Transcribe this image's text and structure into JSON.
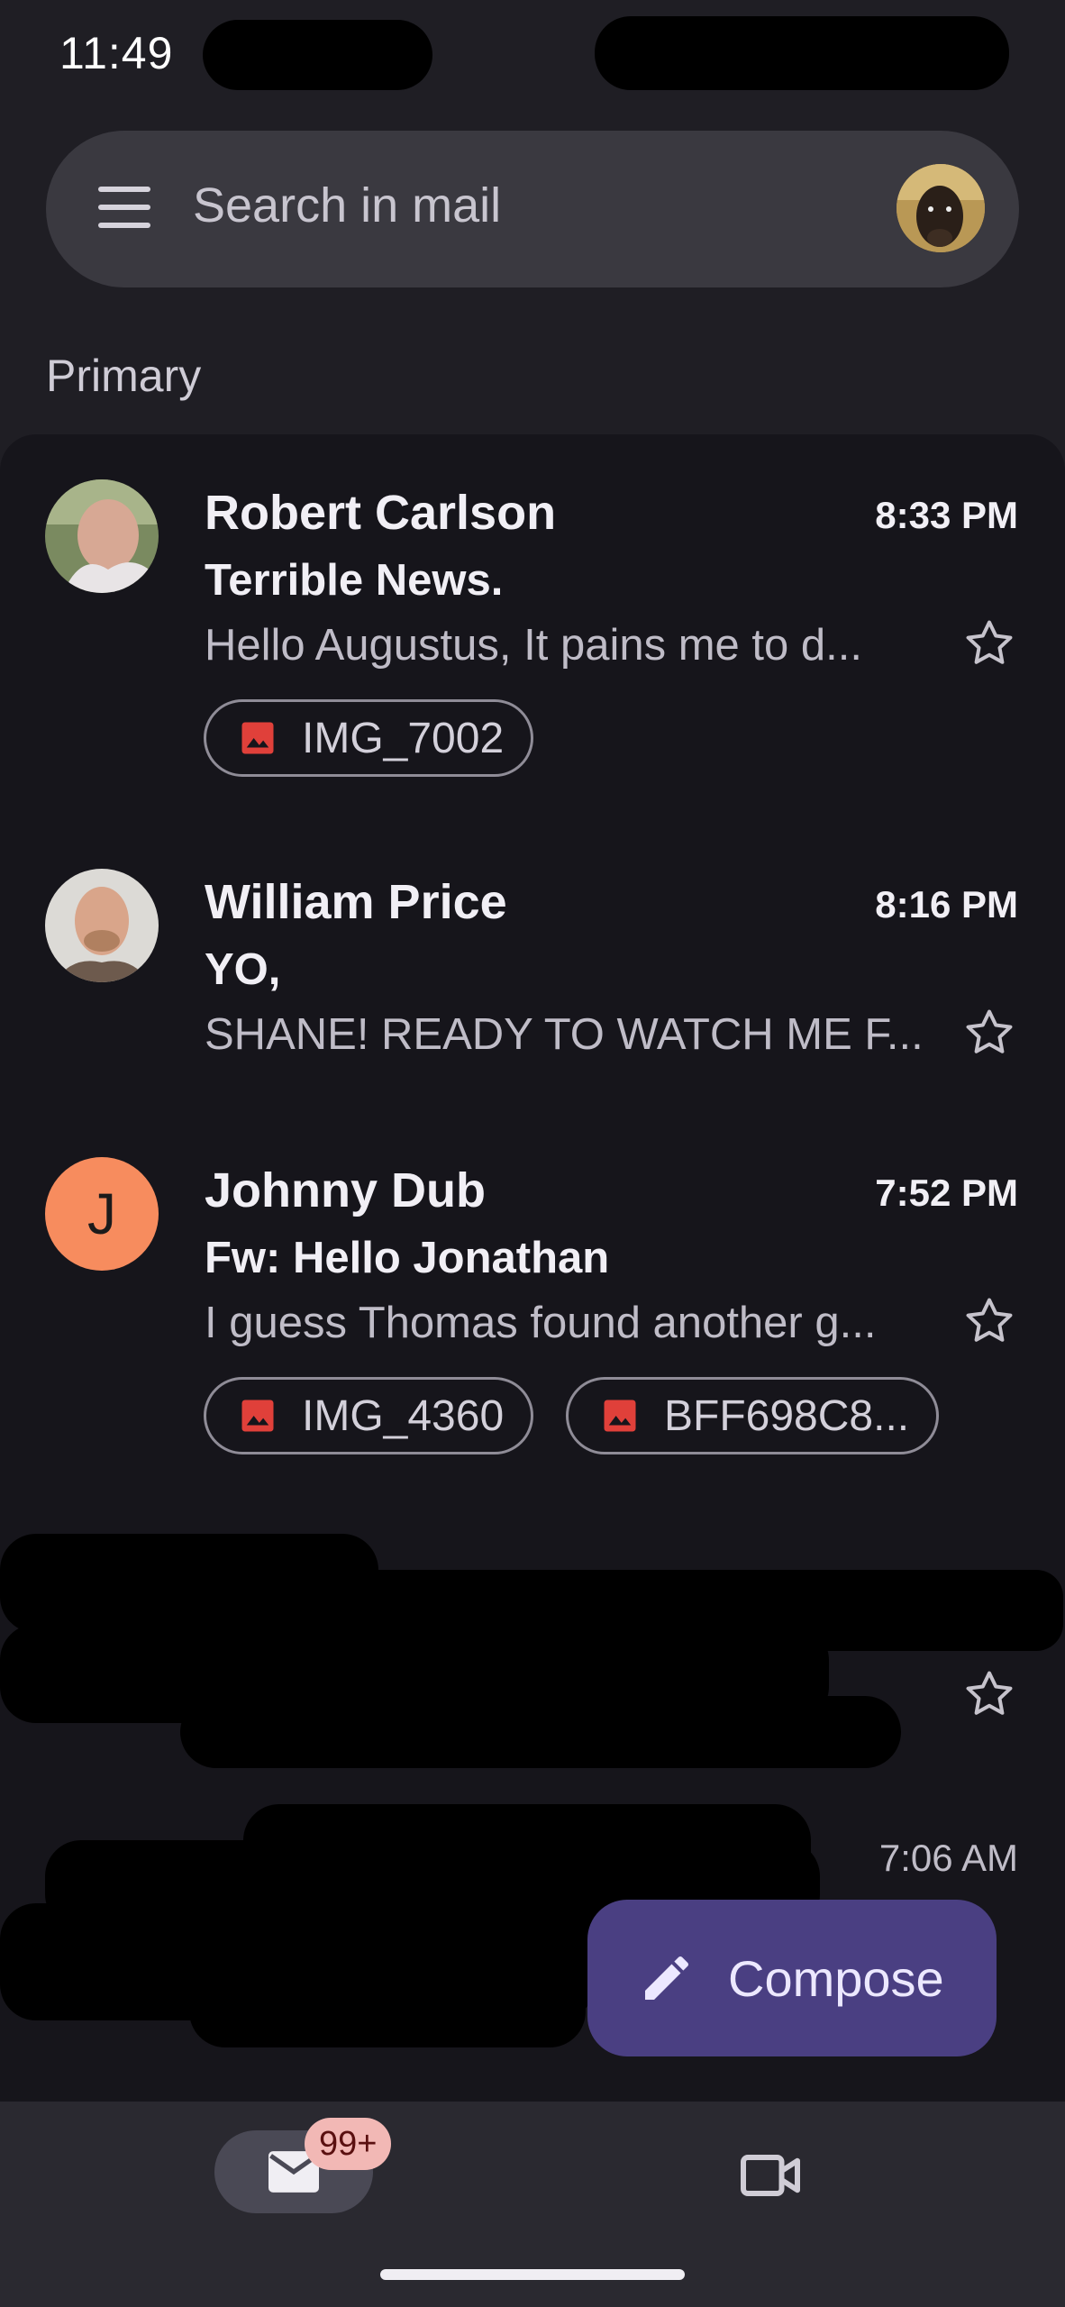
{
  "status_bar": {
    "time": "11:49"
  },
  "search": {
    "placeholder": "Search in mail"
  },
  "section": {
    "label": "Primary"
  },
  "emails": [
    {
      "sender": "Robert Carlson",
      "time": "8:33 PM",
      "subject": "Terrible News.",
      "snippet": "Hello Augustus, It pains me to d...",
      "attachments": [
        "IMG_7002"
      ]
    },
    {
      "sender": "William Price",
      "time": "8:16 PM",
      "subject": "YO,",
      "snippet": "SHANE! READY TO WATCH ME F..."
    },
    {
      "sender": "Johnny Dub",
      "avatar_letter": "J",
      "time": "7:52 PM",
      "subject": "Fw: Hello Jonathan",
      "snippet": "I guess Thomas found another g...",
      "attachments": [
        "IMG_4360",
        "BFF698C8..."
      ]
    },
    {
      "redacted": true
    },
    {
      "redacted": true,
      "time": "7:06 AM"
    }
  ],
  "compose": {
    "label": "Compose"
  },
  "bottom_nav": {
    "mail_badge": "99+"
  },
  "colors": {
    "background": "#1f1e24",
    "list_background": "#16151b",
    "compose": "#4a3f82",
    "letter_avatar": "#f78c5e",
    "attachment_icon": "#e0403a",
    "badge": "#f2b8b5"
  },
  "icons": {
    "menu": "menu-icon",
    "star": "star-outline-icon",
    "attachment": "image-icon",
    "compose": "pencil-icon",
    "mail": "mail-icon",
    "meet": "video-icon"
  }
}
